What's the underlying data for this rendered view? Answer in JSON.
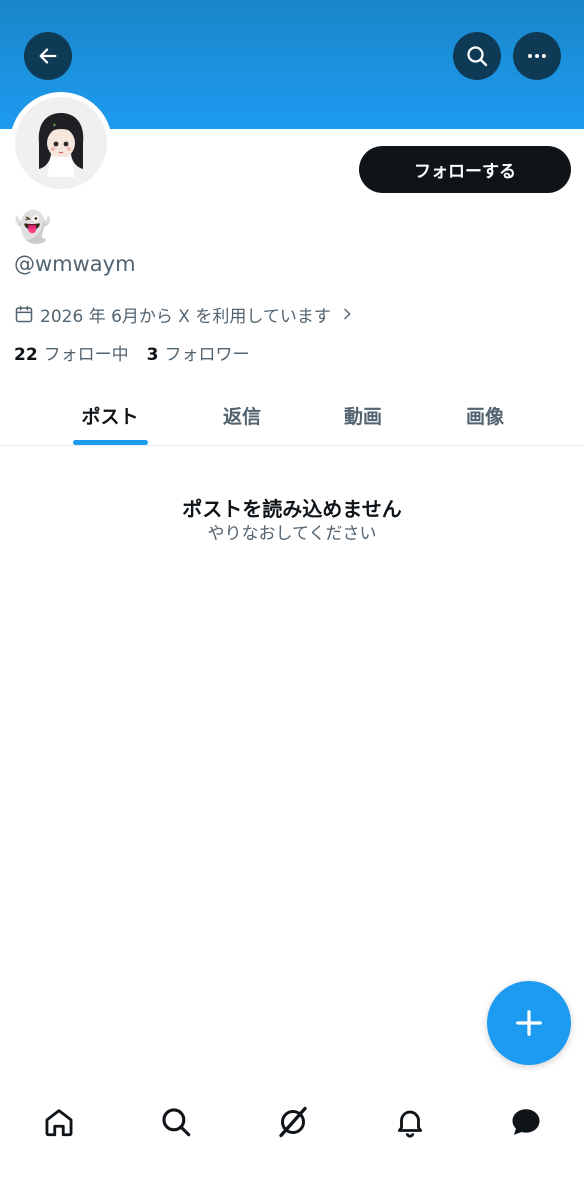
{
  "header": {
    "back_icon": "arrow-left-icon",
    "search_icon": "search-icon",
    "more_icon": "more-horizontal-icon",
    "banner_color": "#1d9bf0"
  },
  "profile": {
    "display_name": "👻",
    "handle": "@wmwaym",
    "joined": "2026 年 6月から X を利用しています",
    "follow_label": "フォローする",
    "following_count": "22",
    "following_label": "フォロー中",
    "followers_count": "3",
    "followers_label": "フォロワー"
  },
  "tabs": [
    {
      "label": "ポスト",
      "active": true
    },
    {
      "label": "返信",
      "active": false
    },
    {
      "label": "動画",
      "active": false
    },
    {
      "label": "画像",
      "active": false
    }
  ],
  "empty_state": {
    "title": "ポストを読み込めません",
    "subtitle": "やりなおしてください"
  },
  "fab": {
    "icon": "plus-icon",
    "color": "#1d9bf0"
  },
  "bottom_nav": {
    "items": [
      {
        "icon": "home-icon"
      },
      {
        "icon": "search-icon"
      },
      {
        "icon": "grok-icon"
      },
      {
        "icon": "bell-icon"
      },
      {
        "icon": "messages-icon"
      }
    ]
  }
}
